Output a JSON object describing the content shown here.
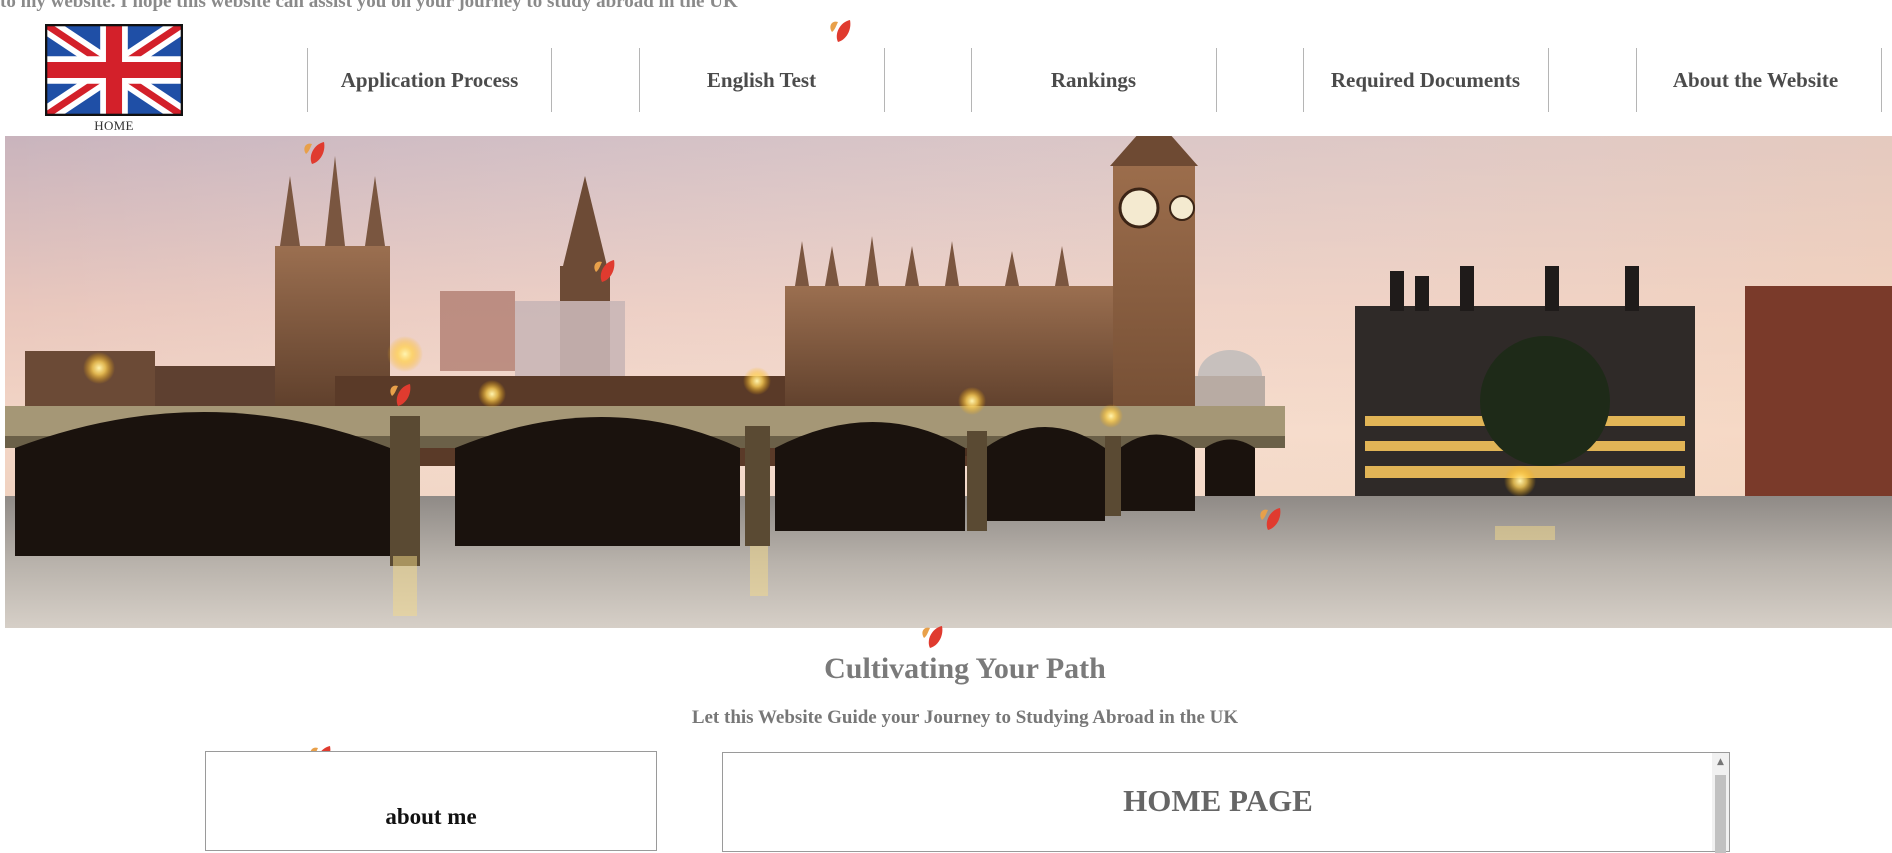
{
  "marquee": {
    "text": "to my website. I hope this website can assist you on your journey to study abroad in the UK"
  },
  "logo": {
    "label": "HOME",
    "icon": "uk-flag-icon"
  },
  "nav": {
    "items": [
      {
        "label": "Application Process"
      },
      {
        "label": "English Test"
      },
      {
        "label": "Rankings"
      },
      {
        "label": "Required Documents"
      },
      {
        "label": "About the Website"
      }
    ]
  },
  "hero": {
    "image": "westminster-bridge-big-ben-sunset-photo"
  },
  "main": {
    "headline": "Cultivating Your Path",
    "subheadline": "Let this Website Guide your Journey to Studying Abroad in the UK"
  },
  "sidebar": {
    "title": "about me"
  },
  "content": {
    "title": "HOME PAGE"
  },
  "decorations": {
    "leaf_icon": "falling-leaf-icon",
    "leaf_colors": [
      "#e03b2f",
      "#e8a04a"
    ]
  },
  "colors": {
    "text_gray": "#7a7a7a",
    "nav_text": "#4b4b4b",
    "border": "#9a9a9a"
  }
}
